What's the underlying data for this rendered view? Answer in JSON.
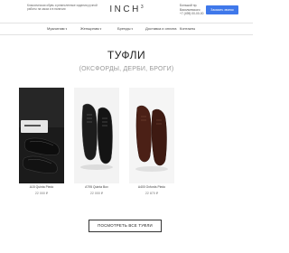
{
  "header": {
    "tagline": "Классическая обувь и ремесленные изделия ручной работы на заказ и в наличии",
    "logo": "INCH",
    "logo_sup": "3",
    "address": "Большой пр. Васильевского",
    "phone": "+7 (495) 00-00-00",
    "callback_label": "Заказать звонок"
  },
  "nav": {
    "items": [
      {
        "label": "Мужчинам",
        "has_dropdown": true
      },
      {
        "label": "Женщинам",
        "has_dropdown": true
      },
      {
        "label": "Бренды",
        "has_dropdown": true
      },
      {
        "label": "Доставка и оплата",
        "has_dropdown": false
      },
      {
        "label": "Контакты",
        "has_dropdown": false
      }
    ]
  },
  "section": {
    "title": "ТУФЛИ",
    "subtitle": "(ОКСФОРДЫ, ДЕРБИ, БРОГИ)"
  },
  "products": [
    {
      "name": "A15 Quinta Piedo",
      "price": "22 000 ₽",
      "color": "#161616",
      "bg": "#1c1c1c",
      "label_bg": "#e9e9e9"
    },
    {
      "name": "A795 Quinta Box",
      "price": "22 000 ₽",
      "color": "#1f1f1f",
      "bg": "#f2f2f2",
      "label_bg": "#f2f2f2"
    },
    {
      "name": "A400 Oxfords Piedo",
      "price": "22 870 ₽",
      "color": "#4a1f16",
      "bg": "#f5f5f5",
      "label_bg": "#f5f5f5"
    }
  ],
  "cta": {
    "label": "ПОСМОТРЕТЬ ВСЕ ТУФЛИ"
  }
}
